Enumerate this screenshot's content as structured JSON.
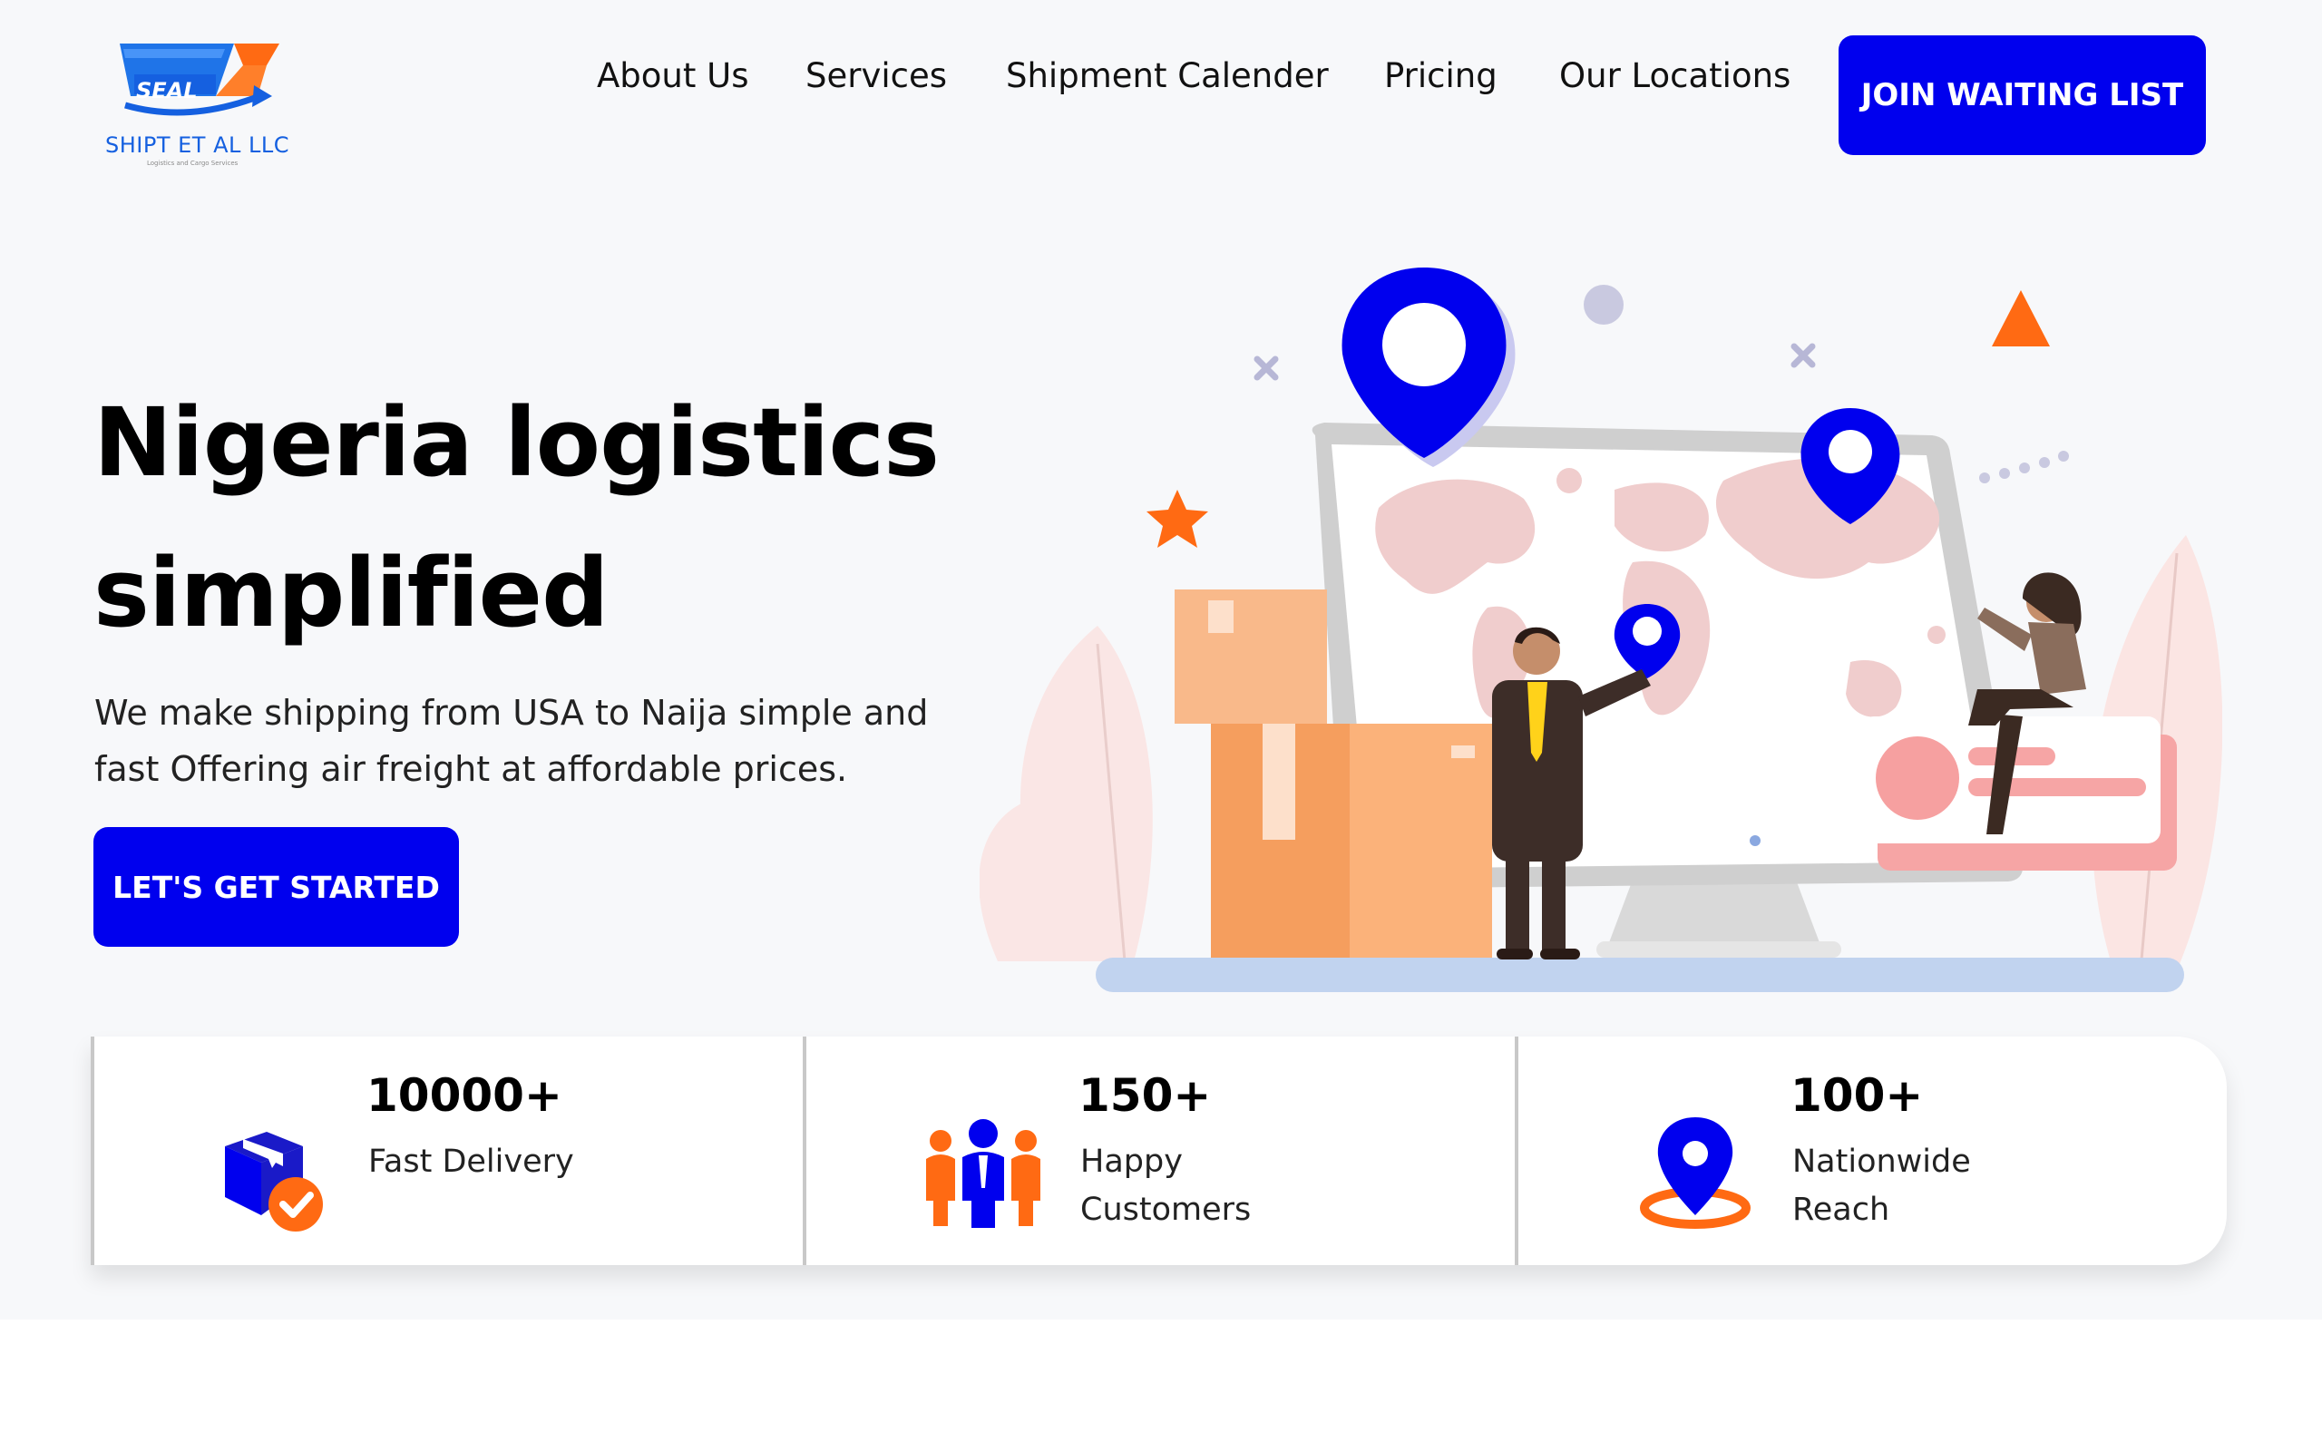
{
  "brand": {
    "logo_mark": "SEAL",
    "name": "SHIPT ET AL LLC",
    "tagline": "Logistics and Cargo Services"
  },
  "nav": {
    "items": [
      {
        "label": "About Us"
      },
      {
        "label": "Services"
      },
      {
        "label": "Shipment Calender"
      },
      {
        "label": "Pricing"
      },
      {
        "label": "Our Locations"
      }
    ],
    "cta_label": "JOIN WAITING LIST"
  },
  "hero": {
    "title_line1": "Nigeria logistics",
    "title_line2": "simplified",
    "subtitle": "We make shipping from USA to Naija simple and fast Offering air freight at affordable prices.",
    "cta_label": "LET'S GET STARTED"
  },
  "stats": [
    {
      "value": "10000+",
      "label": "Fast Delivery",
      "icon": "delivery-box-check-icon"
    },
    {
      "value": "150+",
      "label": "Happy Customers",
      "icon": "customers-group-icon"
    },
    {
      "value": "100+",
      "label": "Nationwide Reach",
      "icon": "location-pin-icon"
    }
  ],
  "colors": {
    "primary": "#0000ee",
    "accent": "#ff6a13",
    "background": "#f7f8fa"
  }
}
